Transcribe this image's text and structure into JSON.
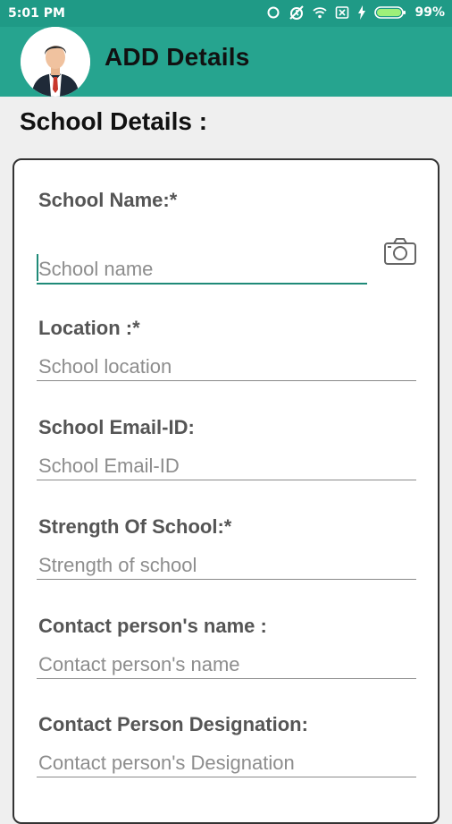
{
  "status_bar": {
    "time": "5:01 PM",
    "battery": "99%",
    "icons": [
      "sync-icon",
      "alarm-off-icon",
      "wifi-icon",
      "no-sim-icon",
      "charging-icon",
      "battery-icon"
    ]
  },
  "app_bar": {
    "title": "ADD Details",
    "avatar_icon": "businessman-avatar"
  },
  "section_title": "School Details :",
  "form": {
    "school_name": {
      "label": "School Name:*",
      "placeholder": "School name"
    },
    "location": {
      "label": "Location :*",
      "placeholder": "School location"
    },
    "email": {
      "label": "School Email-ID:",
      "placeholder": "School Email-ID"
    },
    "strength": {
      "label": "Strength Of School:*",
      "placeholder": "Strength of school"
    },
    "contact_name": {
      "label": "Contact person's name :",
      "placeholder": "Contact person's name"
    },
    "contact_designation": {
      "label": "Contact Person Designation:",
      "placeholder": "Contact person's Designation"
    }
  },
  "camera_icon": "camera-icon",
  "colors": {
    "status_bar": "#1f9a86",
    "app_bar": "#26a48f",
    "accent": "#1f8a78",
    "background": "#efefef"
  }
}
